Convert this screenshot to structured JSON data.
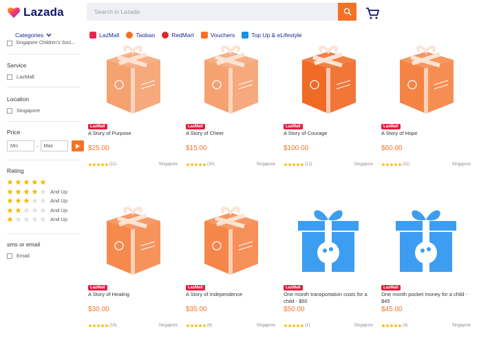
{
  "header": {
    "logo_text": "Lazada",
    "search_placeholder": "Search in Lazada"
  },
  "nav": {
    "categories_label": "Categories",
    "items": [
      {
        "label": "LazMall",
        "color": "#e4264f"
      },
      {
        "label": "Taobao",
        "color": "#f57224"
      },
      {
        "label": "RedMart",
        "color": "#d92b2b"
      },
      {
        "label": "Vouchers",
        "color": "#f57224"
      },
      {
        "label": "Top Up & eLifestyle",
        "color": "#1a8fe3"
      }
    ]
  },
  "sidebar": {
    "cut_item": "Singapore Children's Soci...",
    "service_title": "Service",
    "service_option": "LazMall",
    "location_title": "Location",
    "location_option": "Singapore",
    "price_title": "Price",
    "price_min_placeholder": "Min",
    "price_max_placeholder": "Max",
    "rating_title": "Rating",
    "ratings": [
      {
        "stars": 5,
        "label": ""
      },
      {
        "stars": 4,
        "label": "And Up"
      },
      {
        "stars": 3,
        "label": "And Up"
      },
      {
        "stars": 2,
        "label": "And Up"
      },
      {
        "stars": 1,
        "label": "And Up"
      }
    ],
    "sms_title": "sms or email",
    "sms_option": "Email"
  },
  "colors": {
    "accent": "#f57224",
    "brand_navy": "#0f136d",
    "badge_red": "#e31a3c",
    "star": "#f9b800"
  },
  "products": [
    {
      "badge": "LazMall",
      "title": "A Story of Purpose",
      "price": "$25.00",
      "reviews": "(11)",
      "location": "Singapore",
      "image": "orange-gift-box",
      "shade": "#f5a271",
      "rating": 4.5
    },
    {
      "badge": "LazMall",
      "title": "A Story of Cheer",
      "price": "$15.00",
      "reviews": "(30)",
      "location": "Singapore",
      "image": "orange-gift-box",
      "shade": "#f5a271",
      "rating": 5
    },
    {
      "badge": "LazMall",
      "title": "A Story of Courage",
      "price": "$100.00",
      "reviews": "(12)",
      "location": "Singapore",
      "image": "orange-gift-box",
      "shade": "#f06a26",
      "rating": 5
    },
    {
      "badge": "LazMall",
      "title": "A Story of Hope",
      "price": "$60.00",
      "reviews": "(11)",
      "location": "Singapore",
      "image": "orange-gift-box",
      "shade": "#f58444",
      "rating": 5
    },
    {
      "badge": "LazMall",
      "title": "A Story of Healing",
      "price": "$30.00",
      "reviews": "(15)",
      "location": "Singapore",
      "image": "orange-gift-box",
      "shade": "#f58a4d",
      "rating": 4.5
    },
    {
      "badge": "LazMall",
      "title": "A Story of Independence",
      "price": "$35.00",
      "reviews": "(6)",
      "location": "Singapore",
      "image": "orange-gift-box",
      "shade": "#f5864a",
      "rating": 5
    },
    {
      "badge": "LazMall",
      "title": "One month transportation costs for a child - $50",
      "price": "$50.00",
      "reviews": "(1)",
      "location": "Singapore",
      "image": "blue-gift-box",
      "shade": "#3d9df0",
      "rating": 5
    },
    {
      "badge": "LazMall",
      "title": "One month pocket money for a child - $45",
      "price": "$45.00",
      "reviews": "(4)",
      "location": "Singapore",
      "image": "blue-gift-box",
      "shade": "#3d9df0",
      "rating": 5
    }
  ]
}
